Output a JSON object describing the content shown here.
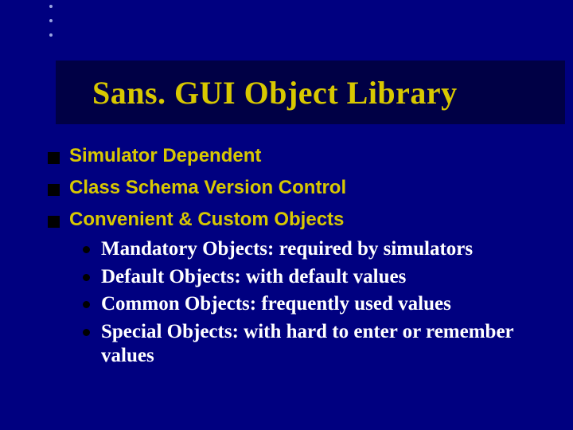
{
  "decor": {
    "dot_count": 3
  },
  "title": "Sans. GUI Object Library",
  "bullets": [
    "Simulator Dependent",
    "Class Schema Version Control",
    "Convenient & Custom Objects"
  ],
  "sub": [
    {
      "lead": "Mandatory Objects:",
      "rest": " required by simulators"
    },
    {
      "lead": "Default Objects:",
      "rest": " with default values"
    },
    {
      "lead": "Common Objects:",
      "rest": " frequently used values"
    },
    {
      "lead": "Special Objects:",
      "rest": " with hard to enter or remember values"
    }
  ]
}
